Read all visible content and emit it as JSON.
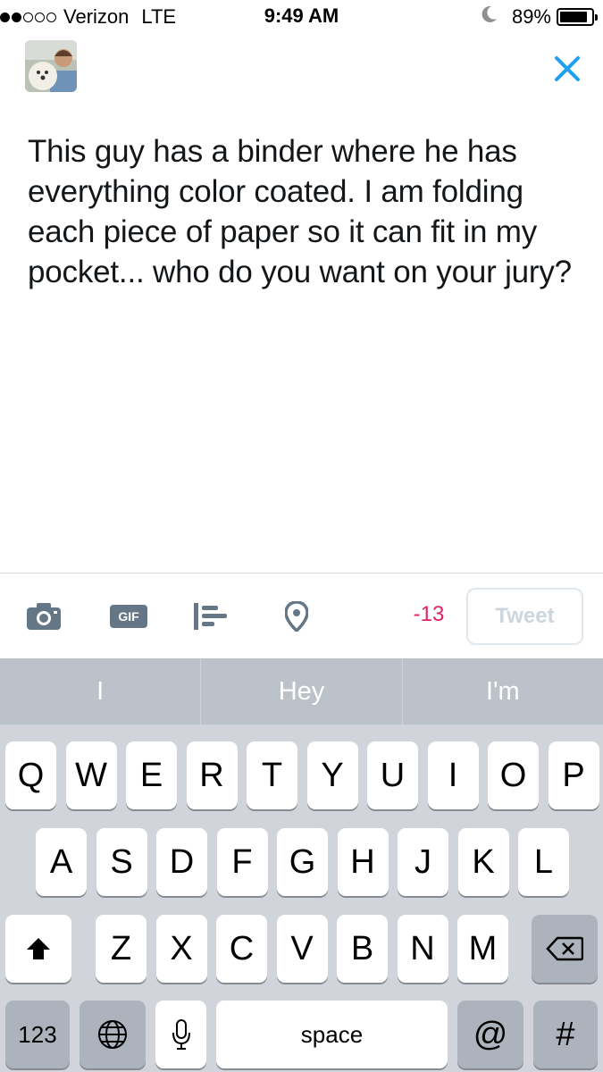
{
  "status_bar": {
    "signal_filled": 2,
    "signal_total": 5,
    "carrier": "Verizon",
    "network": "LTE",
    "time": "9:49 AM",
    "battery_percent": "89%",
    "battery_level": 0.89
  },
  "compose": {
    "avatar_icon": "profile-photo",
    "close_icon": "close-x",
    "text": "This guy has a binder where he has everything color coated. I am folding each piece of paper so it can fit in my pocket... who do you want on your jury?"
  },
  "toolbar": {
    "icons": [
      "camera-icon",
      "gif-icon",
      "poll-icon",
      "location-pin-icon"
    ],
    "gif_label": "GIF",
    "char_count": "-13",
    "tweet_label": "Tweet",
    "accent_color": "#1da1f2",
    "count_color": "#e0245e"
  },
  "keyboard": {
    "suggestions": [
      "I",
      "Hey",
      "I'm"
    ],
    "row1": [
      "Q",
      "W",
      "E",
      "R",
      "T",
      "Y",
      "U",
      "I",
      "O",
      "P"
    ],
    "row2": [
      "A",
      "S",
      "D",
      "F",
      "G",
      "H",
      "J",
      "K",
      "L"
    ],
    "row3": [
      "Z",
      "X",
      "C",
      "V",
      "B",
      "N",
      "M"
    ],
    "numbers_label": "123",
    "space_label": "space",
    "at_label": "@",
    "hash_label": "#"
  }
}
